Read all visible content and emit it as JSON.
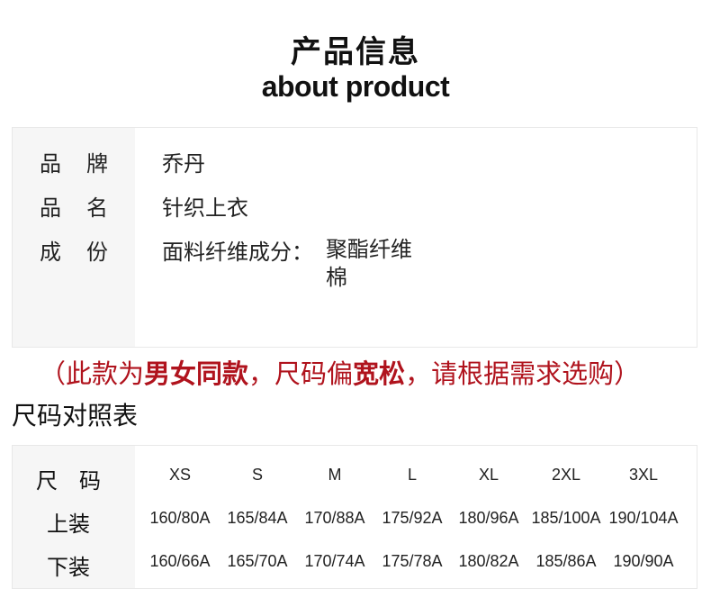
{
  "header": {
    "title_zh": "产品信息",
    "title_en": "about product"
  },
  "info": {
    "brand_label": "品牌",
    "brand_value": "乔丹",
    "name_label": "品名",
    "name_value": "针织上衣",
    "composition_label": "成份",
    "composition_prefix": "面料纤维成分：",
    "materials": [
      "聚酯纤维",
      "棉"
    ]
  },
  "notice": {
    "open": "（此款为",
    "unisex": "男女同款",
    "mid": "，尺码偏",
    "loose": "宽松",
    "close": "，请根据需求选购）"
  },
  "size_chart": {
    "heading": "尺码对照表",
    "size_label": "尺码",
    "top_label": "上装",
    "bottom_label": "下装",
    "sizes": [
      "XS",
      "S",
      "M",
      "L",
      "XL",
      "2XL",
      "3XL"
    ],
    "tops": [
      "160/80A",
      "165/84A",
      "170/88A",
      "175/92A",
      "180/96A",
      "185/100A",
      "190/104A"
    ],
    "bottoms": [
      "160/66A",
      "165/70A",
      "170/74A",
      "175/78A",
      "180/82A",
      "185/86A",
      "190/90A"
    ]
  }
}
